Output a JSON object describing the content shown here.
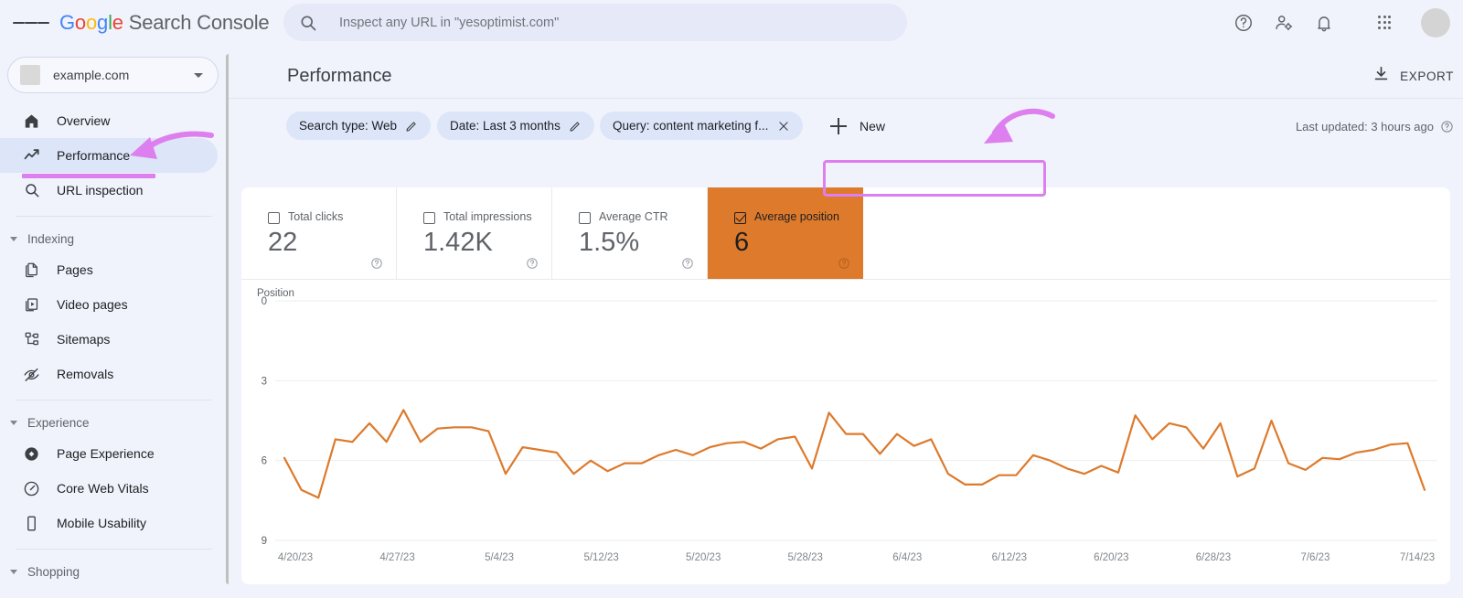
{
  "app": {
    "brand_google": "Google",
    "brand_product": "Search Console",
    "menu_icon": "hamburger-menu-icon"
  },
  "search": {
    "placeholder": "Inspect any URL in \"yesoptimist.com\"",
    "icon": "search-icon"
  },
  "topbar_icons": [
    {
      "name": "help-icon",
      "label": "Help"
    },
    {
      "name": "user-settings-icon",
      "label": "Settings"
    },
    {
      "name": "notifications-bell-icon",
      "label": "Notifications"
    },
    {
      "name": "apps-grid-icon",
      "label": "Google apps"
    },
    {
      "name": "avatar",
      "label": "Account"
    }
  ],
  "sidebar": {
    "property": {
      "label": "example.com",
      "caret": "chevron-down-icon"
    },
    "items": [
      {
        "label": "Overview",
        "icon": "home-icon",
        "active": false
      },
      {
        "label": "Performance",
        "icon": "trending-up-icon",
        "active": true
      },
      {
        "label": "URL inspection",
        "icon": "search-icon",
        "active": false
      }
    ],
    "groups": [
      {
        "label": "Indexing",
        "items": [
          {
            "label": "Pages",
            "icon": "pages-icon"
          },
          {
            "label": "Video pages",
            "icon": "video-pages-icon"
          },
          {
            "label": "Sitemaps",
            "icon": "sitemaps-icon"
          },
          {
            "label": "Removals",
            "icon": "eye-off-icon"
          }
        ]
      },
      {
        "label": "Experience",
        "items": [
          {
            "label": "Page Experience",
            "icon": "page-experience-icon"
          },
          {
            "label": "Core Web Vitals",
            "icon": "speedometer-icon"
          },
          {
            "label": "Mobile Usability",
            "icon": "mobile-icon"
          }
        ]
      },
      {
        "label": "Shopping",
        "items": []
      }
    ]
  },
  "header": {
    "title": "Performance",
    "export_label": "EXPORT",
    "export_icon": "download-icon"
  },
  "filters": {
    "chips": [
      {
        "label": "Search type: Web",
        "action": "pencil-icon",
        "highlighted": false
      },
      {
        "label": "Date: Last 3 months",
        "action": "pencil-icon",
        "highlighted": false
      },
      {
        "label": "Query: content marketing f...",
        "action": "close-icon",
        "highlighted": true
      }
    ],
    "new_label": "New",
    "new_icon": "plus-icon",
    "last_updated": "Last updated: 3 hours ago",
    "last_updated_icon": "help-icon"
  },
  "metrics": [
    {
      "label": "Total clicks",
      "value": "22",
      "selected": false,
      "help_icon": "help-icon"
    },
    {
      "label": "Total impressions",
      "value": "1.42K",
      "selected": false,
      "help_icon": "help-icon"
    },
    {
      "label": "Average CTR",
      "value": "1.5%",
      "selected": false,
      "help_icon": "help-icon"
    },
    {
      "label": "Average position",
      "value": "6",
      "selected": true,
      "help_icon": "help-icon"
    }
  ],
  "colors": {
    "accent_orange": "#DD7A2C",
    "annotation_purple": "#DD7FEE",
    "sidebar_active": "#DDE5F9",
    "chip_bg": "#DDE5F9",
    "page_bg": "#F1F3FC"
  },
  "chart_data": {
    "type": "line",
    "title": "",
    "ylabel": "Position",
    "xlabel": "",
    "ylim": [
      0,
      9
    ],
    "y_inverted": true,
    "yticks": [
      0,
      3,
      6,
      9
    ],
    "grid": true,
    "legend": "none",
    "line_color": "#DD7A2C",
    "xticks": [
      "4/20/23",
      "4/27/23",
      "5/4/23",
      "5/12/23",
      "5/20/23",
      "5/28/23",
      "6/4/23",
      "6/12/23",
      "6/20/23",
      "6/28/23",
      "7/6/23",
      "7/14/23"
    ],
    "x_start": "4/20/23",
    "x_end": "7/16/23",
    "series": [
      {
        "name": "Average position",
        "values": [
          5.9,
          7.1,
          7.4,
          5.2,
          5.3,
          4.6,
          5.3,
          4.1,
          5.3,
          4.8,
          4.75,
          4.75,
          4.9,
          6.5,
          5.5,
          5.6,
          5.7,
          6.5,
          6.0,
          6.4,
          6.1,
          6.1,
          5.8,
          5.6,
          5.8,
          5.5,
          5.35,
          5.3,
          5.55,
          5.2,
          5.1,
          6.3,
          4.2,
          5.0,
          5.0,
          5.75,
          5.0,
          5.45,
          5.2,
          6.5,
          6.9,
          6.9,
          6.55,
          6.55,
          5.8,
          6.0,
          6.3,
          6.5,
          6.2,
          6.45,
          4.3,
          5.2,
          4.6,
          4.75,
          5.55,
          4.6,
          6.6,
          6.3,
          4.5,
          6.1,
          6.35,
          5.9,
          5.95,
          5.7,
          5.6,
          5.4,
          5.35,
          7.1
        ]
      }
    ]
  }
}
